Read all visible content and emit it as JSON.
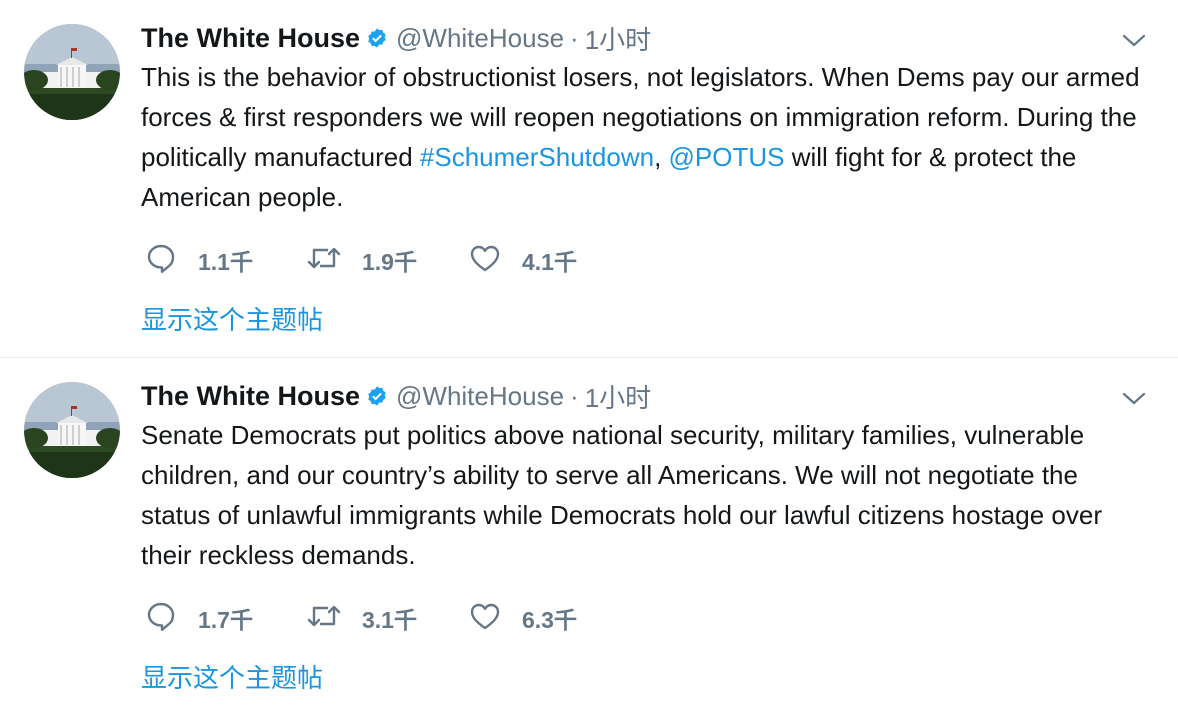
{
  "tweets": [
    {
      "name": "The White House",
      "handle": "@WhiteHouse",
      "separator": "·",
      "time": "1小时",
      "text_parts": [
        {
          "type": "text",
          "value": "This is the behavior of obstructionist losers, not legislators. When Dems pay our armed forces & first responders we will reopen negotiations on immigration reform. During the politically manufactured "
        },
        {
          "type": "link",
          "value": "#SchumerShutdown"
        },
        {
          "type": "text",
          "value": ", "
        },
        {
          "type": "link",
          "value": "@POTUS"
        },
        {
          "type": "text",
          "value": " will fight for & protect the American people."
        }
      ],
      "replies": "1.1千",
      "retweets": "1.9千",
      "likes": "4.1千",
      "show_thread": "显示这个主题帖"
    },
    {
      "name": "The White House",
      "handle": "@WhiteHouse",
      "separator": "·",
      "time": "1小时",
      "text_parts": [
        {
          "type": "text",
          "value": "Senate Democrats put politics above national security, military families, vulnerable children, and our country’s ability to serve all Americans. We will not negotiate the status of unlawful immigrants while Democrats hold our lawful citizens hostage over their reckless demands."
        }
      ],
      "replies": "1.7千",
      "retweets": "3.1千",
      "likes": "6.3千",
      "show_thread": "显示这个主题帖"
    }
  ],
  "colors": {
    "link": "#1b95e0",
    "secondary_text": "#657786",
    "verified_badge": "#1da1f2",
    "divider": "#e6ecf0"
  },
  "icons": [
    "verified-badge-icon",
    "chevron-down-icon",
    "reply-icon",
    "retweet-icon",
    "like-icon",
    "white-house-avatar"
  ]
}
